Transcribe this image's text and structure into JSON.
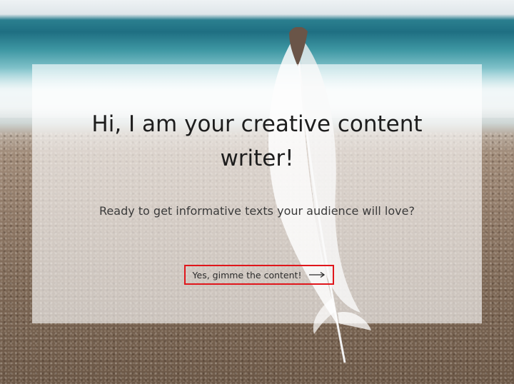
{
  "hero": {
    "headline": "Hi, I am your creative content writer!",
    "subheadline": "Ready to get informative texts your audience will love?",
    "cta_label": "Yes, gimme the content!",
    "cta_icon": "arrow-right-icon",
    "cta_border_color": "#e0161b"
  }
}
